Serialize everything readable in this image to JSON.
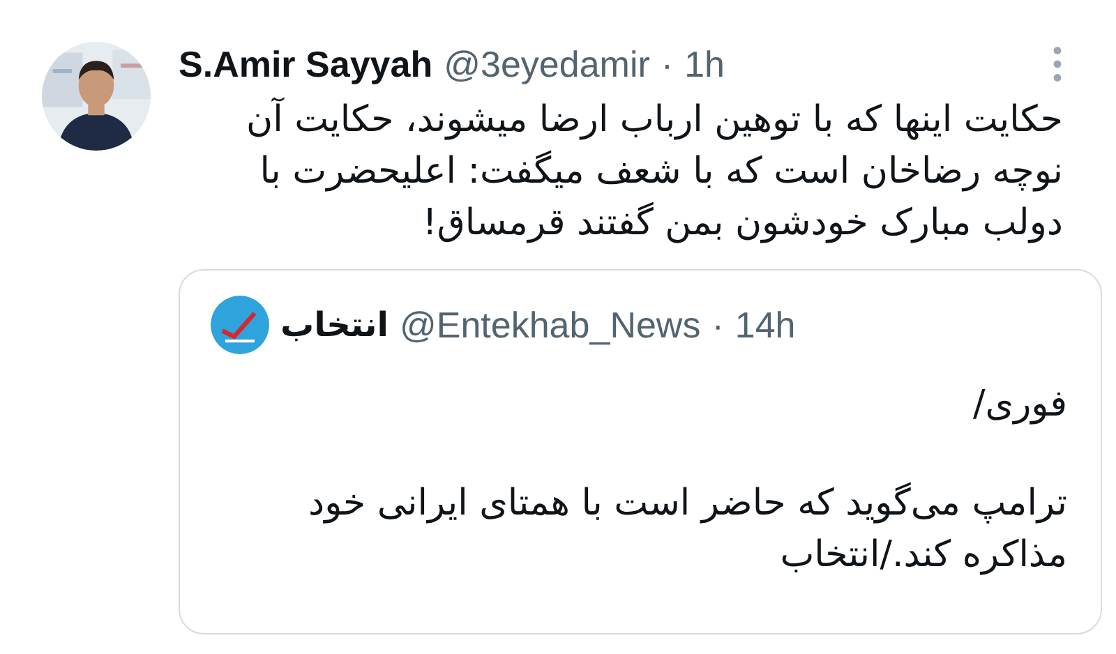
{
  "tweet": {
    "name": "S.Amir Sayyah",
    "handle": "@3eyedamir",
    "separator": "·",
    "time": "1h",
    "text": "حکایت اینها که با توهین ارباب ارضا میشوند، حکایت آن نوچه رضاخان است که با شعف میگفت: اعلیحضرت با دولب مبارک خودشون بمن گفتند قرمساق!",
    "quoted": {
      "name": "انتخاب",
      "handle": "@Entekhab_News",
      "separator": "·",
      "time": "14h",
      "paragraphs": [
        "فوری/",
        "ترامپ می‌گوید که حاضر است با همتای ایرانی خود مذاکره کند./انتخاب"
      ]
    }
  }
}
